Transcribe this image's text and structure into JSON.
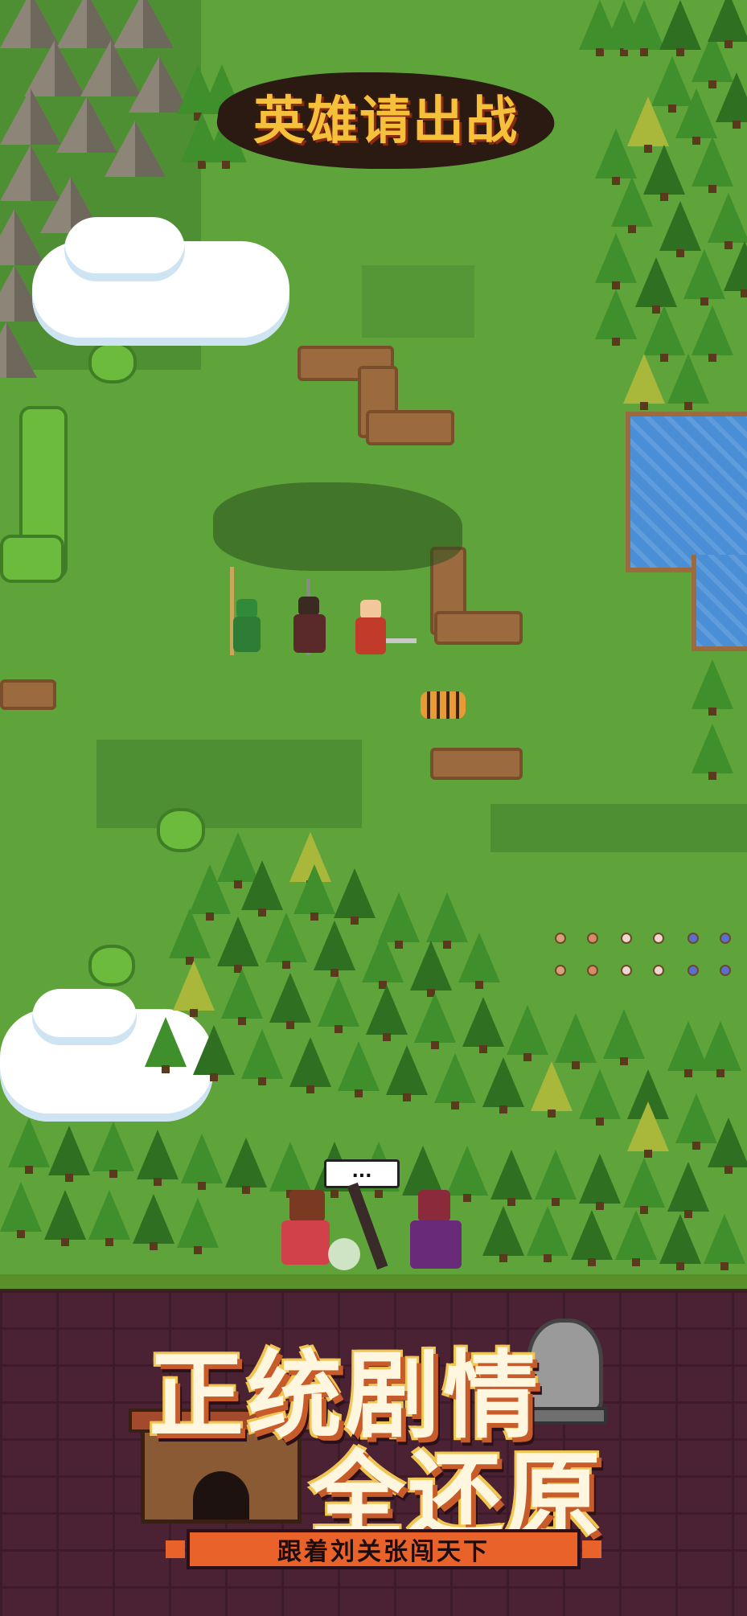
{
  "title_logo": "英雄请出战",
  "speech_bubble": "...",
  "banner": {
    "headline_line1": "正统剧情",
    "headline_line2": "全还原",
    "tagline": "跟着刘关张闯天下"
  },
  "colors": {
    "grass": "#5fa33b",
    "banner_bg": "#4a2233",
    "tagline_bar": "#e8622a",
    "headline_outline": "#c85b2a",
    "lake": "#4a8fd6"
  },
  "icons": {
    "heroes": [
      "guan-yu-sprite",
      "zhang-fei-sprite",
      "liu-bei-sprite"
    ],
    "creature": "tiger-sprite",
    "bottom_characters": [
      "female-hero-sprite",
      "robed-general-sprite"
    ],
    "decor": [
      "stone-lion-icon",
      "city-gate-icon"
    ]
  }
}
